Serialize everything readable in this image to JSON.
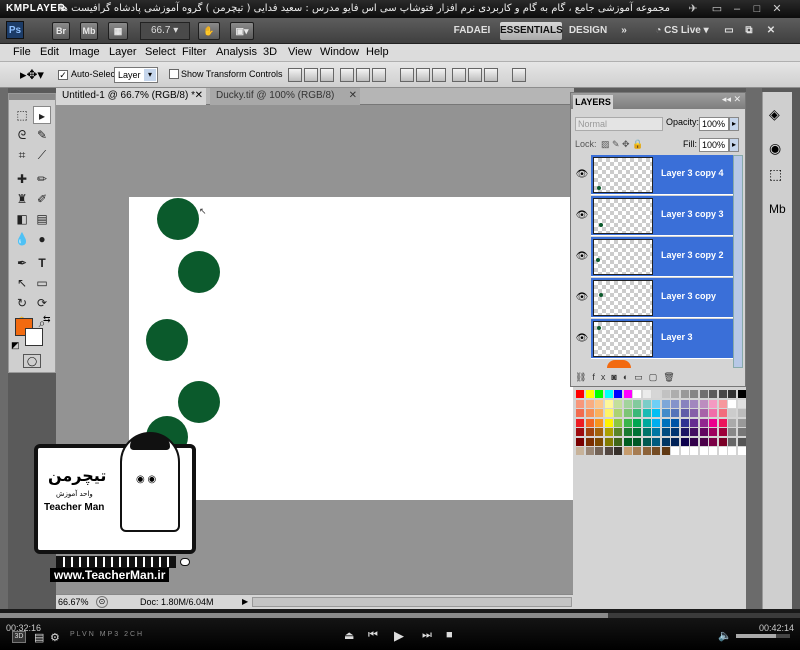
{
  "player": {
    "brand": "KMPLAYER",
    "caption": "مجموعه آموزشی جامع ، گام به گام و کاربردی نرم افزار فتوشاپ سی اس فایو مدرس : سعید فدایی ( تیچرمن ) گروه آموزشی پادشاه گرافیست ها",
    "time_elapsed": "00:32:16",
    "time_total": "00:42:14",
    "progress": 0.76,
    "badges": [
      "PLVN",
      "MP3",
      "2CH"
    ]
  },
  "ps": {
    "logo": "Ps",
    "zoom_value": "66.7",
    "workspaces": [
      "FADAEI",
      "ESSENTIALS",
      "DESIGN"
    ],
    "active_workspace": "ESSENTIALS",
    "cs_live": "CS Live"
  },
  "menu": [
    "File",
    "Edit",
    "Image",
    "Layer",
    "Select",
    "Filter",
    "Analysis",
    "3D",
    "View",
    "Window",
    "Help"
  ],
  "options": {
    "auto_select_label": "Auto-Select:",
    "auto_select_value": "Layer",
    "show_transform_label": "Show Transform Controls"
  },
  "tabs": [
    {
      "label": "Untitled-1 @ 66.7% (RGB/8) *",
      "active": true
    },
    {
      "label": "Ducky.tif @ 100% (RGB/8)",
      "active": false
    }
  ],
  "status": {
    "zoom": "66.67%",
    "doc": "Doc: 1.80M/6.04M"
  },
  "colors": {
    "foreground": "#f26a10",
    "background": "#ffffff",
    "circle": "#0b5a2c",
    "layer_selected": "#3a6fd8"
  },
  "layers_panel": {
    "tab": "LAYERS",
    "blend_mode": "Normal",
    "opacity_label": "Opacity:",
    "opacity_value": "100%",
    "lock_label": "Lock:",
    "fill_label": "Fill:",
    "fill_value": "100%",
    "layers": [
      {
        "name": "Layer 3 copy 4",
        "visible": true,
        "selected": true
      },
      {
        "name": "Layer 3 copy 3",
        "visible": true,
        "selected": true
      },
      {
        "name": "Layer 3 copy 2",
        "visible": true,
        "selected": true
      },
      {
        "name": "Layer 3 copy",
        "visible": true,
        "selected": true
      },
      {
        "name": "Layer 3",
        "visible": true,
        "selected": true
      }
    ]
  },
  "watermark": {
    "brand_fa": "تیچرمن",
    "tagline_fa": "واحد آموزش",
    "brand_en": "Teacher Man",
    "url": "www.TeacherMan.ir"
  }
}
